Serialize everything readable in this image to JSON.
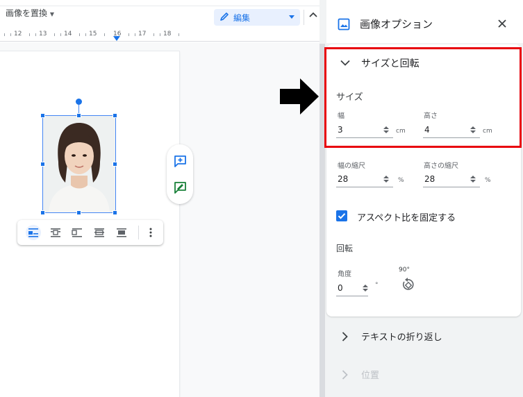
{
  "toolbar": {
    "replace_image_label": "画像を置換",
    "edit_mode_label": "編集"
  },
  "ruler": {
    "numbers": [
      "12",
      "13",
      "14",
      "15",
      "16",
      "17",
      "18"
    ]
  },
  "panel": {
    "title": "画像オプション",
    "size_rotation": {
      "title": "サイズと回転",
      "size_heading": "サイズ",
      "width_label": "幅",
      "width_value": "3",
      "width_unit": "cm",
      "height_label": "高さ",
      "height_value": "4",
      "height_unit": "cm",
      "width_scale_label": "幅の縮尺",
      "width_scale_value": "28",
      "width_scale_unit": "%",
      "height_scale_label": "高さの縮尺",
      "height_scale_value": "28",
      "height_scale_unit": "%",
      "lock_aspect_label": "アスペクト比を固定する",
      "lock_aspect_checked": true,
      "rotation_heading": "回転",
      "angle_label": "角度",
      "angle_value": "0",
      "angle_unit": "°",
      "rotate_90_label": "90°"
    },
    "text_wrap_title": "テキストの折り返し",
    "position_title": "位置"
  },
  "colors": {
    "accent": "#1a73e8",
    "annotation_red": "#e8000b",
    "panel_bg": "#f1f3f4"
  }
}
